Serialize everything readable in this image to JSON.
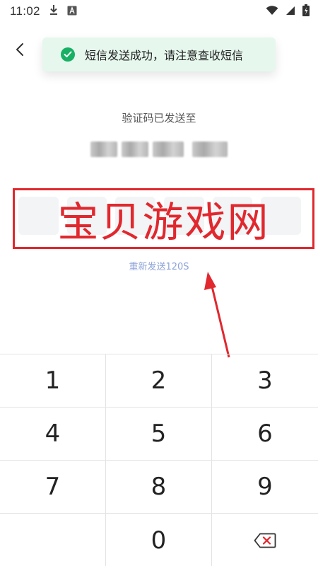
{
  "status_bar": {
    "time": "11:02",
    "icons": [
      "download-icon",
      "font-app-icon",
      "wifi-icon",
      "signal-icon",
      "battery-charging-icon"
    ]
  },
  "toast": {
    "icon": "check-circle-icon",
    "text": "短信发送成功，请注意查收短信",
    "color": "#18b064"
  },
  "verify": {
    "hint": "验证码已发送至",
    "resend": "重新发送120S"
  },
  "watermark": {
    "text": "宝贝游戏网",
    "color": "#e0282e"
  },
  "keypad": {
    "keys": [
      "1",
      "2",
      "3",
      "4",
      "5",
      "6",
      "7",
      "8",
      "9",
      "",
      "0",
      "backspace"
    ]
  }
}
